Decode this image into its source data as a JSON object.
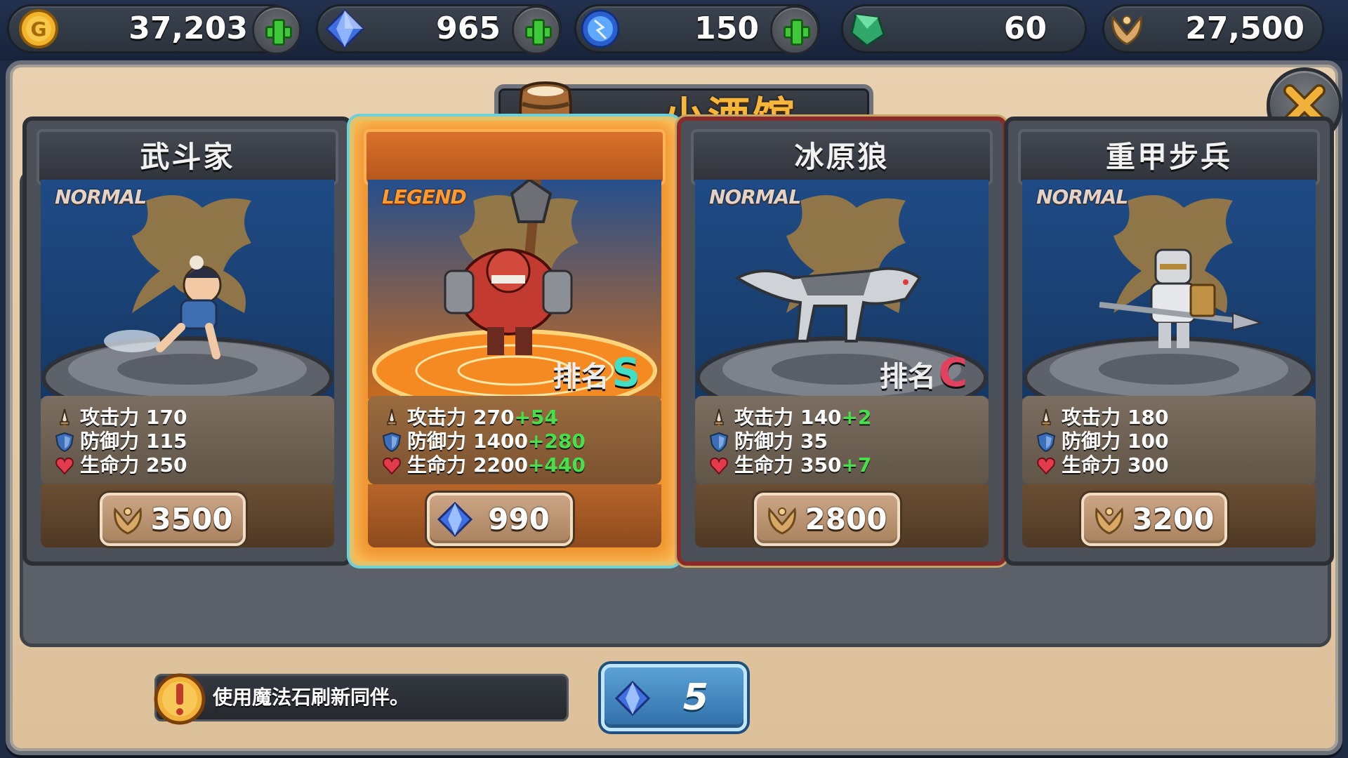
{
  "resources": {
    "gold": {
      "icon": "gold-coin-icon",
      "value": "37,203"
    },
    "diamond": {
      "icon": "blue-diamond-icon",
      "value": "965"
    },
    "orb": {
      "icon": "lightning-orb-icon",
      "value": "150"
    },
    "emerald": {
      "icon": "green-gem-icon",
      "value": "60"
    },
    "honor": {
      "icon": "honor-laurel-icon",
      "value": "27,500"
    }
  },
  "title": "小酒馆",
  "cards": [
    {
      "name": "武斗家",
      "rarity": "NORMAL",
      "rank_label": "",
      "rank_grade": "",
      "stats": {
        "attack_label": "攻击力",
        "attack": "170",
        "attack_bonus": "",
        "defense_label": "防御力",
        "defense": "115",
        "defense_bonus": "",
        "hp_label": "生命力",
        "hp": "250",
        "hp_bonus": ""
      },
      "price": "3500",
      "price_currency": "honor-laurel-icon"
    },
    {
      "name": "",
      "rarity": "LEGEND",
      "rank_label": "排名",
      "rank_grade": "S",
      "stats": {
        "attack_label": "攻击力",
        "attack": "270",
        "attack_bonus": "+54",
        "defense_label": "防御力",
        "defense": "1400",
        "defense_bonus": "+280",
        "hp_label": "生命力",
        "hp": "2200",
        "hp_bonus": "+440"
      },
      "price": "990",
      "price_currency": "blue-diamond-icon"
    },
    {
      "name": "冰原狼",
      "rarity": "NORMAL",
      "rank_label": "排名",
      "rank_grade": "C",
      "stats": {
        "attack_label": "攻击力",
        "attack": "140",
        "attack_bonus": "+2",
        "defense_label": "防御力",
        "defense": "35",
        "defense_bonus": "",
        "hp_label": "生命力",
        "hp": "350",
        "hp_bonus": "+7"
      },
      "price": "2800",
      "price_currency": "honor-laurel-icon"
    },
    {
      "name": "重甲步兵",
      "rarity": "NORMAL",
      "rank_label": "",
      "rank_grade": "",
      "stats": {
        "attack_label": "攻击力",
        "attack": "180",
        "attack_bonus": "",
        "defense_label": "防御力",
        "defense": "100",
        "defense_bonus": "",
        "hp_label": "生命力",
        "hp": "300",
        "hp_bonus": ""
      },
      "price": "3200",
      "price_currency": "honor-laurel-icon"
    }
  ],
  "hint": "使用魔法石刷新同伴。",
  "refresh": {
    "cost": "5",
    "icon": "blue-diamond-icon"
  },
  "colors": {
    "bonus": "#47e04a",
    "rank_s": "#3fe0c6",
    "rank_c": "#e0415d",
    "title": "#f5b63a",
    "legend_glow": "#f0902c"
  }
}
